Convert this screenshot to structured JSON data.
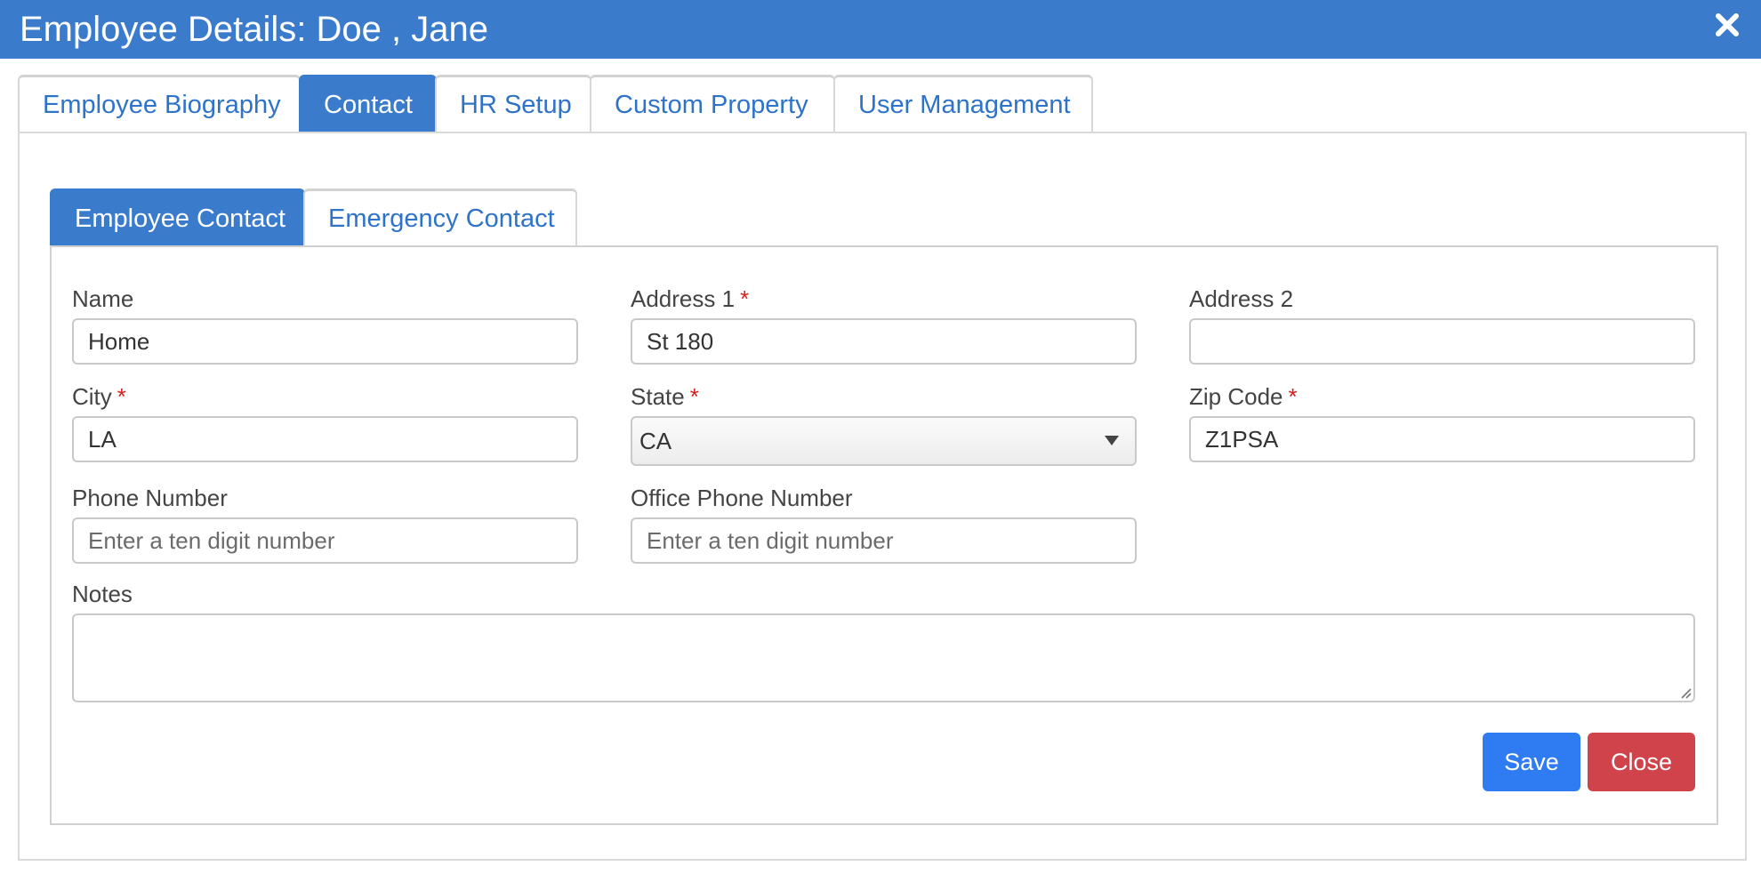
{
  "window": {
    "title": "Employee Details: Doe , Jane",
    "close_icon": "close-icon"
  },
  "outer_tabs": [
    {
      "label": "Employee Biography",
      "active": false
    },
    {
      "label": "Contact",
      "active": true
    },
    {
      "label": "HR Setup",
      "active": false
    },
    {
      "label": "Custom Property",
      "active": false
    },
    {
      "label": "User Management",
      "active": false
    }
  ],
  "inner_tabs": [
    {
      "label": "Employee Contact",
      "active": true
    },
    {
      "label": "Emergency Contact",
      "active": false
    }
  ],
  "form": {
    "name": {
      "label": "Name",
      "value": "Home"
    },
    "address1": {
      "label": "Address 1",
      "value": "St 180",
      "required": true
    },
    "address2": {
      "label": "Address 2",
      "value": ""
    },
    "city": {
      "label": "City",
      "value": "LA",
      "required": true
    },
    "state": {
      "label": "State",
      "value": "CA",
      "required": true
    },
    "zip": {
      "label": "Zip Code",
      "value": "Z1PSA",
      "required": true
    },
    "phone": {
      "label": "Phone Number",
      "value": "",
      "placeholder": "Enter a ten digit number"
    },
    "office_phone": {
      "label": "Office Phone Number",
      "value": "",
      "placeholder": "Enter a ten digit number"
    },
    "notes": {
      "label": "Notes",
      "value": ""
    },
    "required_marker": "*"
  },
  "buttons": {
    "save": "Save",
    "close": "Close"
  },
  "colors": {
    "primary": "#3a7bcc",
    "save": "#2f7bf2",
    "close": "#d0434b",
    "required": "#d62020"
  }
}
